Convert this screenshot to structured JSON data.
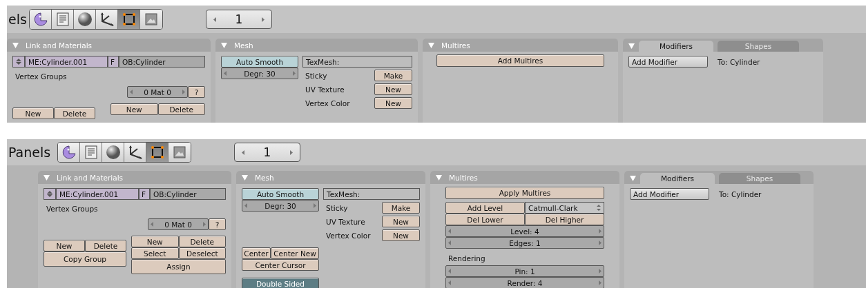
{
  "screenshots": [
    {
      "header": {
        "label": "els",
        "tabs": [
          {
            "kind": "logic",
            "selected": false
          },
          {
            "kind": "script",
            "selected": false
          },
          {
            "kind": "shading",
            "selected": false
          },
          {
            "kind": "object",
            "selected": false
          },
          {
            "kind": "editing",
            "selected": true
          },
          {
            "kind": "scene",
            "selected": false
          }
        ],
        "page": "1"
      },
      "panels": [
        {
          "kind": "link_materials",
          "title": "Link and Materials",
          "mesh_name": "ME:Cylinder.001",
          "fake_user": "F",
          "object_name": "OB:Cylinder",
          "vertex_groups_label": "Vertex Groups",
          "material_spinner": "0 Mat 0",
          "material_help": "?",
          "group_buttons": [
            "New",
            "Delete"
          ],
          "material_buttons": [
            "New",
            "Delete"
          ]
        },
        {
          "kind": "mesh",
          "title": "Mesh",
          "auto_smooth": {
            "label": "Auto Smooth",
            "on": false
          },
          "degree": "Degr: 30",
          "texmesh": "TexMesh:",
          "rows": [
            {
              "label": "Sticky",
              "button": "Make"
            },
            {
              "label": "UV Texture",
              "button": "New"
            },
            {
              "label": "Vertex Color",
              "button": "New"
            }
          ]
        },
        {
          "kind": "multires",
          "title": "Multires",
          "items": [
            {
              "kind": "button",
              "label": "Add Multires"
            }
          ]
        },
        {
          "kind": "modifiers",
          "tabs": [
            {
              "label": "Modifiers",
              "selected": true
            },
            {
              "label": "Shapes",
              "selected": false
            }
          ],
          "add_button": "Add Modifier",
          "target": "To: Cylinder"
        }
      ]
    },
    {
      "header": {
        "label": "Panels",
        "tabs": [
          {
            "kind": "logic",
            "selected": false
          },
          {
            "kind": "script",
            "selected": false
          },
          {
            "kind": "shading",
            "selected": false
          },
          {
            "kind": "object",
            "selected": false
          },
          {
            "kind": "editing",
            "selected": true
          },
          {
            "kind": "scene",
            "selected": false
          }
        ],
        "page": "1"
      },
      "panels": [
        {
          "kind": "link_materials",
          "title": "Link and Materials",
          "mesh_name": "ME:Cylinder.001",
          "fake_user": "F",
          "object_name": "OB:Cylinder",
          "vertex_groups_label": "Vertex Groups",
          "material_spinner": "0 Mat 0",
          "material_help": "?",
          "group_buttons": [
            "New",
            "Delete",
            "Copy Group"
          ],
          "material_buttons": [
            "New",
            "Delete",
            "Select",
            "Deselect",
            "Assign"
          ]
        },
        {
          "kind": "mesh",
          "title": "Mesh",
          "auto_smooth": {
            "label": "Auto Smooth",
            "on": false
          },
          "degree": "Degr: 30",
          "texmesh": "TexMesh:",
          "rows": [
            {
              "label": "Sticky",
              "button": "Make"
            },
            {
              "label": "UV Texture",
              "button": "New"
            },
            {
              "label": "Vertex Color",
              "button": "New"
            }
          ],
          "center_buttons": [
            "Center",
            "Center New",
            "Center Cursor"
          ],
          "double_sided": {
            "label": "Double Sided",
            "on": true
          }
        },
        {
          "kind": "multires",
          "title": "Multires",
          "items": [
            {
              "kind": "button",
              "label": "Apply Multires"
            },
            {
              "kind": "button_menu",
              "label": "Add Level",
              "value": "Catmull-Clark"
            },
            {
              "kind": "pair",
              "labels": [
                "Del Lower",
                "Del Higher"
              ]
            },
            {
              "kind": "spinner",
              "label": "Level: 4"
            },
            {
              "kind": "spinner",
              "label": "Edges: 1"
            },
            {
              "kind": "label",
              "label": "Rendering"
            },
            {
              "kind": "spinner",
              "label": "Pin: 1"
            },
            {
              "kind": "spinner",
              "label": "Render: 4"
            }
          ]
        },
        {
          "kind": "modifiers",
          "tabs": [
            {
              "label": "Modifiers",
              "selected": true
            },
            {
              "label": "Shapes",
              "selected": false
            }
          ],
          "add_button": "Add Modifier",
          "target": "To: Cylinder"
        }
      ]
    }
  ]
}
